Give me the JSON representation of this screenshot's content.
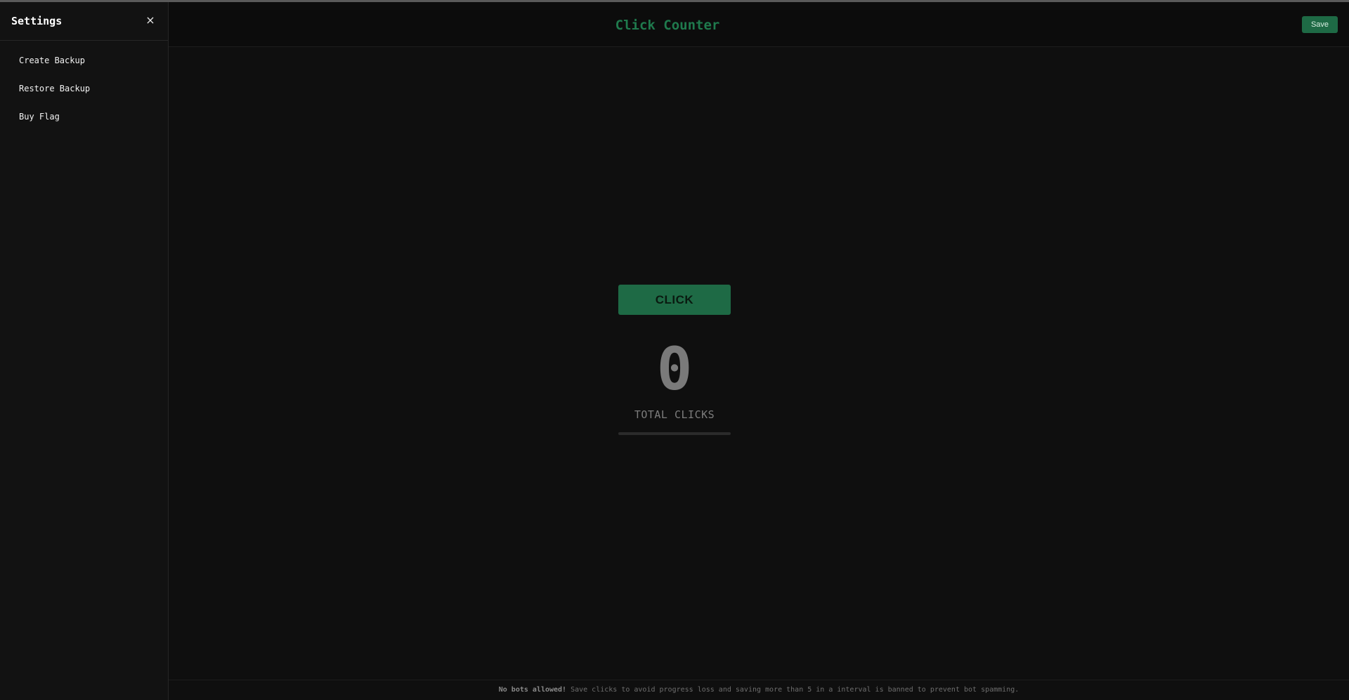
{
  "sidebar": {
    "title": "Settings",
    "close_icon": "×",
    "items": [
      {
        "label": "Create Backup"
      },
      {
        "label": "Restore Backup"
      },
      {
        "label": "Buy Flag"
      }
    ]
  },
  "header": {
    "title": "Click Counter",
    "save_label": "Save"
  },
  "counter": {
    "button_label": "CLICK",
    "value": "0",
    "label": "TOTAL CLICKS",
    "progress_percent": 0
  },
  "footer": {
    "warning": "No bots allowed!",
    "message": " Save clicks to avoid progress loss and saving more than 5 in a interval is banned to prevent bot spamming."
  },
  "colors": {
    "accent": "#1e6a45",
    "title": "#1f7a4d",
    "background": "#0f0f0f"
  }
}
